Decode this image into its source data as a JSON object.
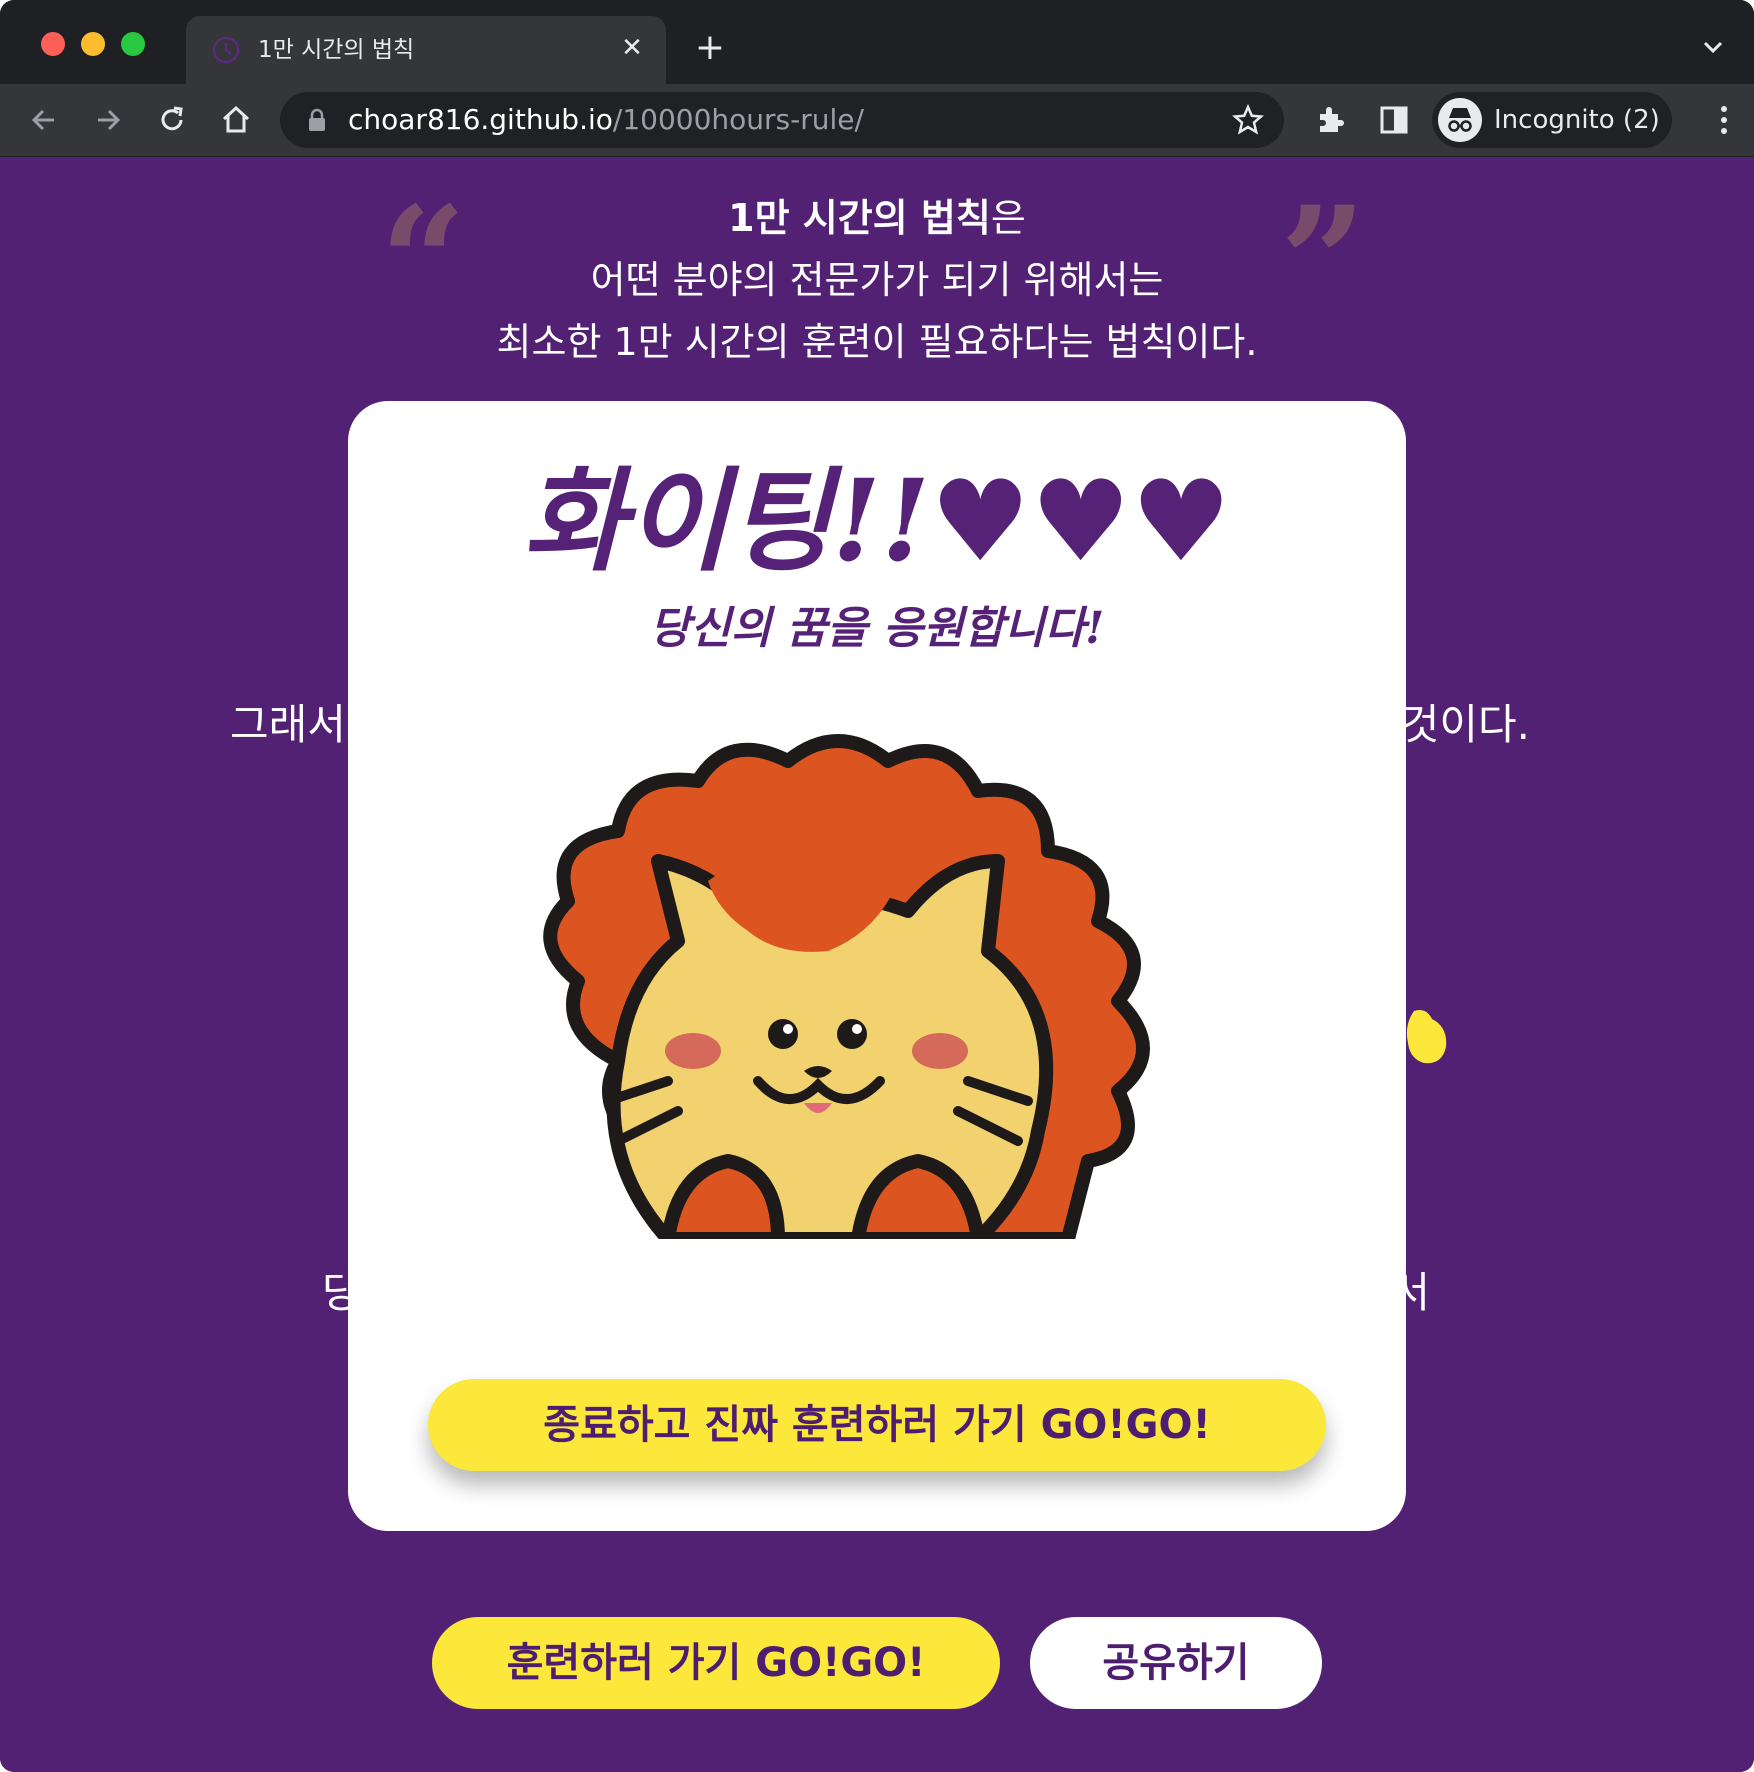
{
  "browser": {
    "tab_title": "1만 시간의 법칙",
    "new_tab_label": "+",
    "close_tab_label": "✕",
    "url_host": "choar816.github.io",
    "url_path": "/10000hours-rule/",
    "profile_label": "Incognito (2)"
  },
  "page": {
    "quote_open": "“",
    "quote_close": "”",
    "intro_strong": "1만 시간의 법칙",
    "intro_tail": "은",
    "intro_line2": "어떤 분야의 전문가가 되기 위해서는",
    "intro_line3": "최소한 1만 시간의 훈련이 필요하다는 법칙이다.",
    "partial_left_1": "그래서",
    "partial_right_1": "것이다.",
    "partial_left_2": "당",
    "partial_right_2": "서",
    "train_button": "훈련하러 가기 GO!GO!",
    "share_button": "공유하기"
  },
  "modal": {
    "cheer_title": "화이팅!!",
    "cheer_hearts": "♥♥♥",
    "cheer_sub": "당신의 꿈을 응원합니다!",
    "close_button": "종료하고 진짜 훈련하러 가기 GO!GO!"
  },
  "colors": {
    "page_bg": "#522174",
    "accent_yellow": "#fbe83a",
    "accent_purple": "#552277"
  },
  "icons": [
    "back-icon",
    "forward-icon",
    "reload-icon",
    "home-icon",
    "lock-icon",
    "star-icon",
    "extensions-icon",
    "side-panel-icon",
    "incognito-icon",
    "menu-icon",
    "tab-search-icon"
  ]
}
